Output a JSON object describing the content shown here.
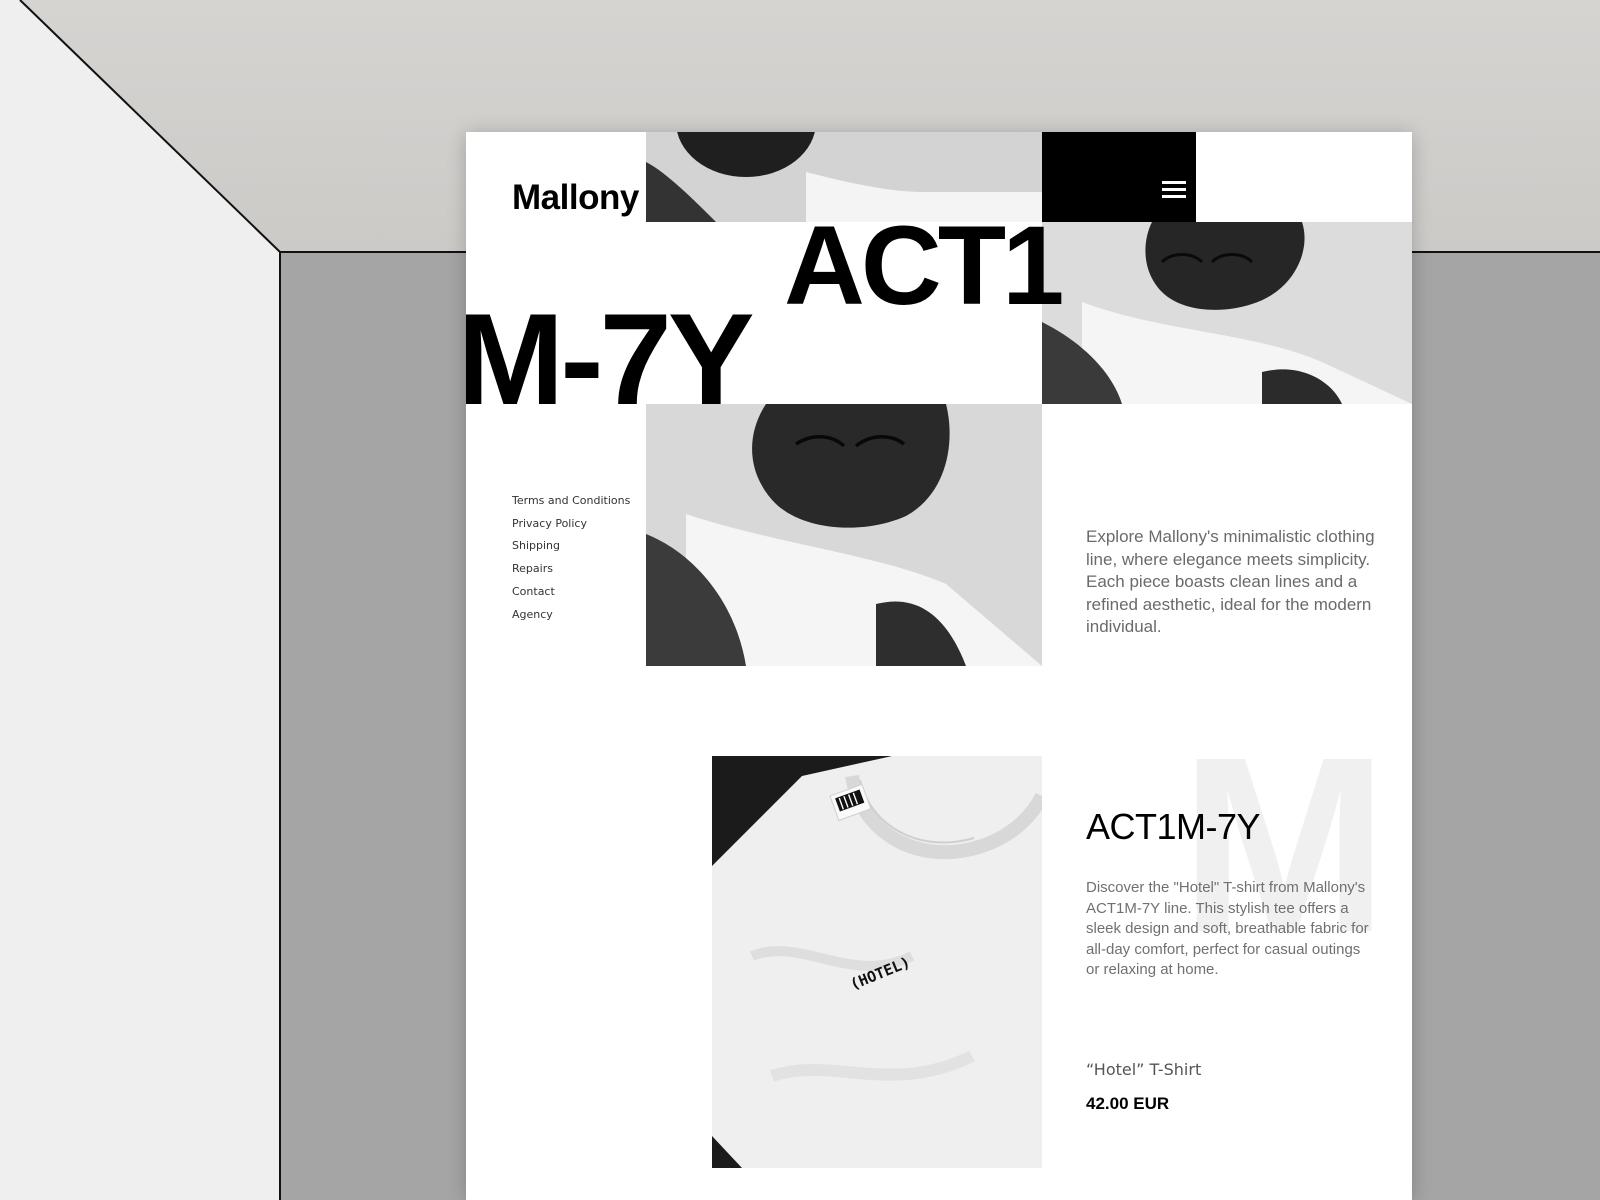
{
  "site": {
    "logo": "Mallony",
    "headline_line1": "ACT1",
    "headline_line2": "M-7Y"
  },
  "menu": {
    "icon": "hamburger-menu-icon"
  },
  "footer_links": [
    "Terms and Conditions",
    "Privacy Policy",
    "Shipping",
    "Repairs",
    "Contact",
    "Agency"
  ],
  "intro": "Explore Mallony's minimalistic clothing line, where elegance meets simplicity. Each piece boasts clean lines and a refined aesthetic, ideal for the modern individual.",
  "product": {
    "watermark": "M",
    "title": "ACT1M-7Y",
    "description": "Discover the \"Hotel\" T-shirt from Mallony's ACT1M-7Y line. This stylish tee offers a sleek design and soft, breathable fabric for all-day comfort, perfect for casual outings or relaxing at home.",
    "shirt_print": "(HOTEL)",
    "name": "“Hotel” T-Shirt",
    "price": "42.00 EUR"
  },
  "colors": {
    "page_background": "#ffffff",
    "text_primary": "#000000",
    "text_muted": "#6a6a6a",
    "menu_block": "#000000",
    "mockup_wall": "#a5a5a5"
  }
}
